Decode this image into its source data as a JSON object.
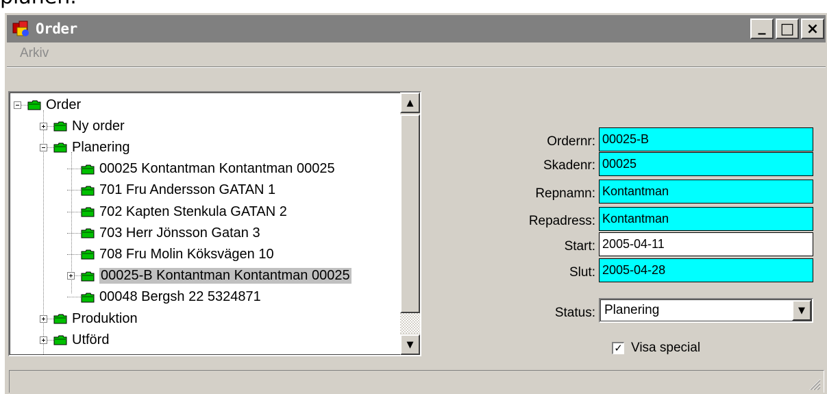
{
  "page": {
    "cut_text": "planen."
  },
  "window": {
    "title": "Order",
    "minimize_glyph": "_",
    "maximize_glyph": "□",
    "close_glyph": "×"
  },
  "menu": {
    "items": [
      "Arkiv"
    ]
  },
  "tree": {
    "root": {
      "label": "Order",
      "state": "expanded"
    },
    "nodes": [
      {
        "label": "Ny order",
        "level": 1,
        "state": "collapsed"
      },
      {
        "label": "Planering",
        "level": 1,
        "state": "expanded"
      },
      {
        "label": "00025 Kontantman Kontantman 00025",
        "level": 2,
        "state": "leaf"
      },
      {
        "label": "701 Fru Andersson GATAN 1",
        "level": 2,
        "state": "leaf"
      },
      {
        "label": "702 Kapten Stenkula GATAN 2",
        "level": 2,
        "state": "leaf"
      },
      {
        "label": "703 Herr Jönsson Gatan 3",
        "level": 2,
        "state": "leaf"
      },
      {
        "label": "708 Fru Molin Köksvägen 10",
        "level": 2,
        "state": "leaf"
      },
      {
        "label": "00025-B Kontantman Kontantman 00025",
        "level": 2,
        "state": "collapsed",
        "selected": true
      },
      {
        "label": "00048  Bergsh 22 5324871",
        "level": 2,
        "state": "leaf"
      },
      {
        "label": "Produktion",
        "level": 1,
        "state": "collapsed"
      },
      {
        "label": "Utförd",
        "level": 1,
        "state": "collapsed"
      }
    ],
    "folder_color": "#00c000"
  },
  "form": {
    "ordernr_label": "Ordernr:",
    "ordernr_value": "00025-B",
    "skadenr_label": "Skadenr:",
    "skadenr_value": "00025",
    "repnamn_label": "Repnamn:",
    "repnamn_value": "Kontantman",
    "repadress_label": "Repadress:",
    "repadress_value": "Kontantman",
    "start_label": "Start:",
    "start_value": "2005-04-11",
    "slut_label": "Slut:",
    "slut_value": "2005-04-28",
    "status_label": "Status:",
    "status_value": "Planering",
    "visa_special_label": "Visa special",
    "visa_special_checked": true,
    "check_glyph": "✓",
    "highlight_color": "#00ffff"
  }
}
